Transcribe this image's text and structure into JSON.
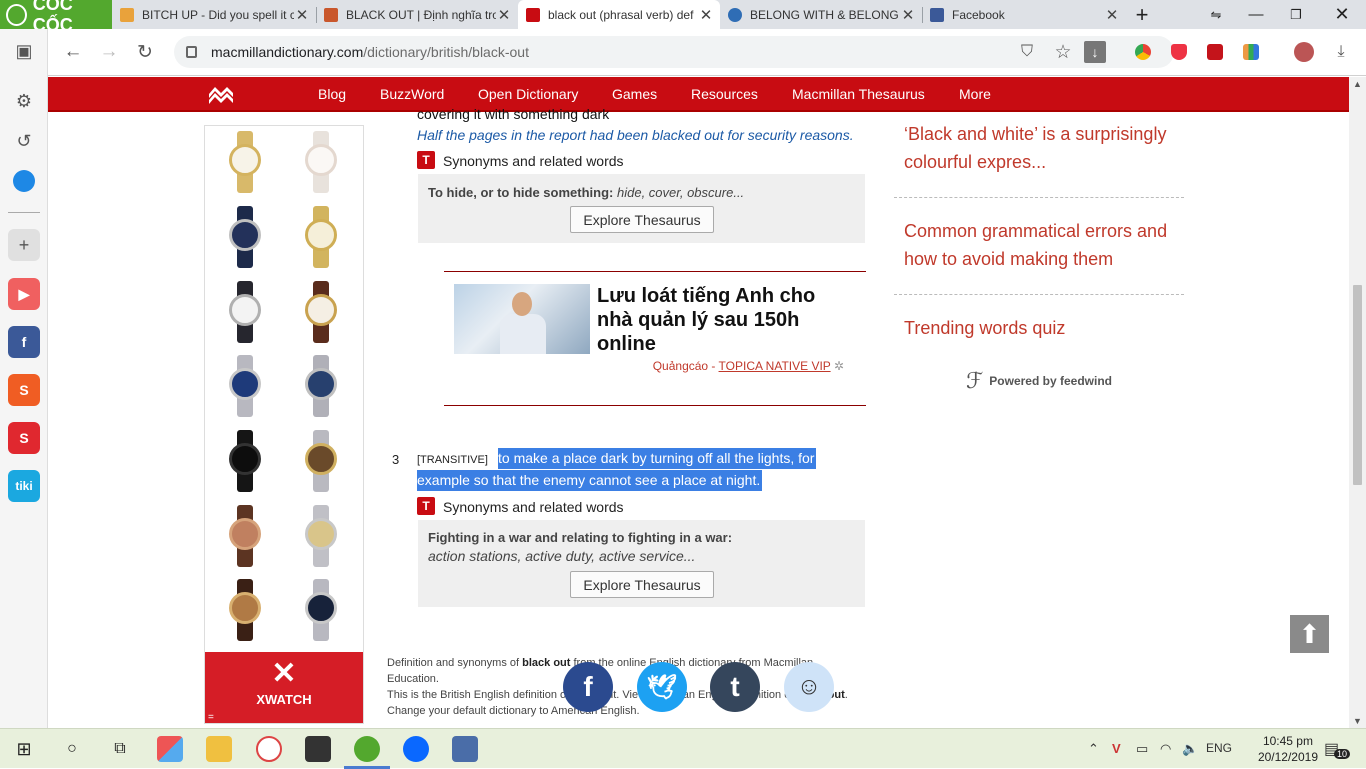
{
  "browser": {
    "brand": "CỐC CỐC",
    "tabs": [
      {
        "title": "BITCH UP - Did you spell it c",
        "favicon_color": "#e9a23b"
      },
      {
        "title": "BLACK OUT | Định nghĩa tro",
        "favicon_color": "#c9572c"
      },
      {
        "title": "black out (phrasal verb) def",
        "favicon_color": "#c80c12",
        "active": true
      },
      {
        "title": "BELONG WITH & BELONG T",
        "favicon_color": "#2f6db5"
      },
      {
        "title": "Facebook",
        "favicon_color": "#3b5998"
      }
    ],
    "url_host": "macmillandictionary.com",
    "url_path": "/dictionary/british/black-out"
  },
  "site_nav": {
    "items": [
      "Blog",
      "BuzzWord",
      "Open Dictionary",
      "Games",
      "Resources",
      "Macmillan Thesaurus",
      "More"
    ]
  },
  "ad_side": {
    "brand": "XWATCH",
    "eq": "="
  },
  "sense2": {
    "def_tail": "covering it with something dark",
    "example": "Half the pages in the report had been blacked out for security reasons.",
    "syn_label": "Synonyms and related words",
    "category": "To hide, or to hide something:",
    "synonyms": "hide, cover, obscure...",
    "button": "Explore Thesaurus"
  },
  "native_ad": {
    "headline": "Lưu loát tiếng Anh cho nhà quản lý sau 150h online",
    "sponsor_prefix": "Quảngcáo - ",
    "sponsor_brand": "TOPICA NATIVE VIP"
  },
  "sense3": {
    "number": "3",
    "grammar": "[TRANSITIVE]",
    "def_line1": " to make a place dark by turning off all the lights, for",
    "def_line2": "example so that the enemy cannot see a place at night.",
    "syn_label": "Synonyms and related words",
    "category": "Fighting in a war and relating to fighting in a war:",
    "synonyms": "action stations, active duty, active service...",
    "button": "Explore Thesaurus"
  },
  "feed": {
    "items": [
      "‘Black and white’ is a surprisingly colourful expres...",
      "Common grammatical errors and how to avoid making them",
      "Trending words quiz"
    ],
    "powered": "Powered by feedwind"
  },
  "footer": {
    "line1_a": "Definition and synonyms of ",
    "line1_b": "black out",
    "line1_c": " from the online English dictionary from Macmillan",
    "line2": "Education.",
    "line3_a": "This is the British English definition of black out. View American English definition of ",
    "line3_b": "black out",
    "line3_c": ".",
    "line4": "Change your default dictionary to American English."
  },
  "taskbar": {
    "language": "ENG",
    "time": "10:45 pm",
    "date": "20/12/2019",
    "notifications": "10"
  },
  "colors": {
    "brand_red": "#c80c12",
    "link_red": "#c0392b",
    "selection_blue": "#3b7fe4",
    "coccoc_green": "#53a82e"
  }
}
